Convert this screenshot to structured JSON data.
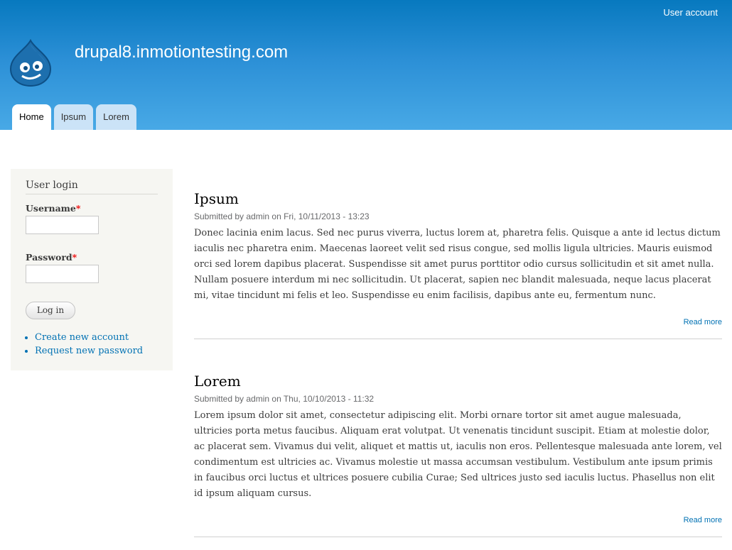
{
  "header": {
    "site_name": "drupal8.inmotiontesting.com",
    "secondary_menu": "User account",
    "logo_icon": "drupal-drop-logo",
    "colors": {
      "top": "#0779bf",
      "bottom": "#48a9e6"
    }
  },
  "tabs": [
    {
      "label": "Home",
      "active": true
    },
    {
      "label": "Ipsum",
      "active": false
    },
    {
      "label": "Lorem",
      "active": false
    }
  ],
  "sidebar": {
    "title": "User login",
    "username_label": "Username",
    "password_label": "Password",
    "required_mark": "*",
    "login_button": "Log in",
    "links": [
      "Create new account",
      "Request new password"
    ]
  },
  "articles": [
    {
      "title": "Ipsum",
      "submitted": "Submitted by admin on Fri, 10/11/2013 - 13:23",
      "body": "Donec lacinia enim lacus. Sed nec purus viverra, luctus lorem at, pharetra felis. Quisque a ante id lectus dictum iaculis nec pharetra enim. Maecenas laoreet velit sed risus congue, sed mollis ligula ultricies. Mauris euismod orci sed lorem dapibus placerat. Suspendisse sit amet purus porttitor odio cursus sollicitudin et sit amet nulla. Nullam posuere interdum mi nec sollicitudin. Ut placerat, sapien nec blandit malesuada, neque lacus placerat mi, vitae tincidunt mi felis et leo. Suspendisse eu enim facilisis, dapibus ante eu, fermentum nunc.",
      "read_more": "Read more"
    },
    {
      "title": "Lorem",
      "submitted": "Submitted by admin on Thu, 10/10/2013 - 11:32",
      "body": "Lorem ipsum dolor sit amet, consectetur adipiscing elit. Morbi ornare tortor sit amet augue malesuada, ultricies porta metus faucibus. Aliquam erat volutpat. Ut venenatis tincidunt suscipit. Etiam at molestie dolor, ac placerat sem. Vivamus dui velit, aliquet et mattis ut, iaculis non eros. Pellentesque malesuada ante lorem, vel condimentum est ultricies ac. Vivamus molestie ut massa accumsan vestibulum. Vestibulum ante ipsum primis in faucibus orci luctus et ultrices posuere cubilia Curae; Sed ultrices justo sed iaculis luctus. Phasellus non elit id ipsum aliquam cursus.",
      "read_more": "Read more"
    }
  ]
}
